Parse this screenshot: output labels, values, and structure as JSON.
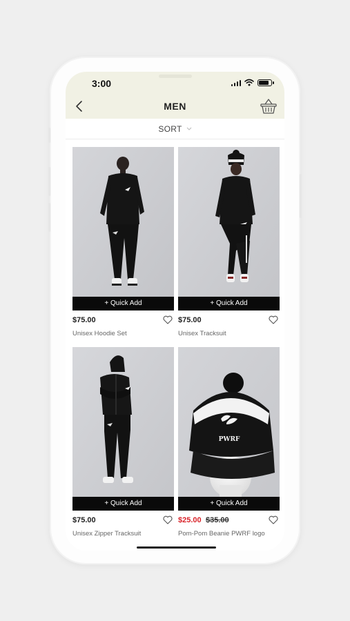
{
  "status_bar": {
    "time": "3:00"
  },
  "nav": {
    "title": "MEN"
  },
  "sort": {
    "label": "SORT"
  },
  "products": [
    {
      "price": "$75.00",
      "name": "Unisex Hoodie Set",
      "quick_add": "+ Quick Add"
    },
    {
      "price": "$75.00",
      "name": "Unisex Tracksuit",
      "quick_add": "+ Quick Add"
    },
    {
      "price": "$75.00",
      "name": "Unisex Zipper Tracksuit",
      "quick_add": "+ Quick Add"
    },
    {
      "price": "$25.00",
      "old_price": "$35.00",
      "name": "Pom-Pom Beanie PWRF logo",
      "quick_add": "+ Quick Add",
      "beanie_text": "PWRF"
    }
  ],
  "colors": {
    "header_bg": "#f1f1e4",
    "sale": "#d9242b",
    "quick_add_bg": "#0a0a0a"
  }
}
